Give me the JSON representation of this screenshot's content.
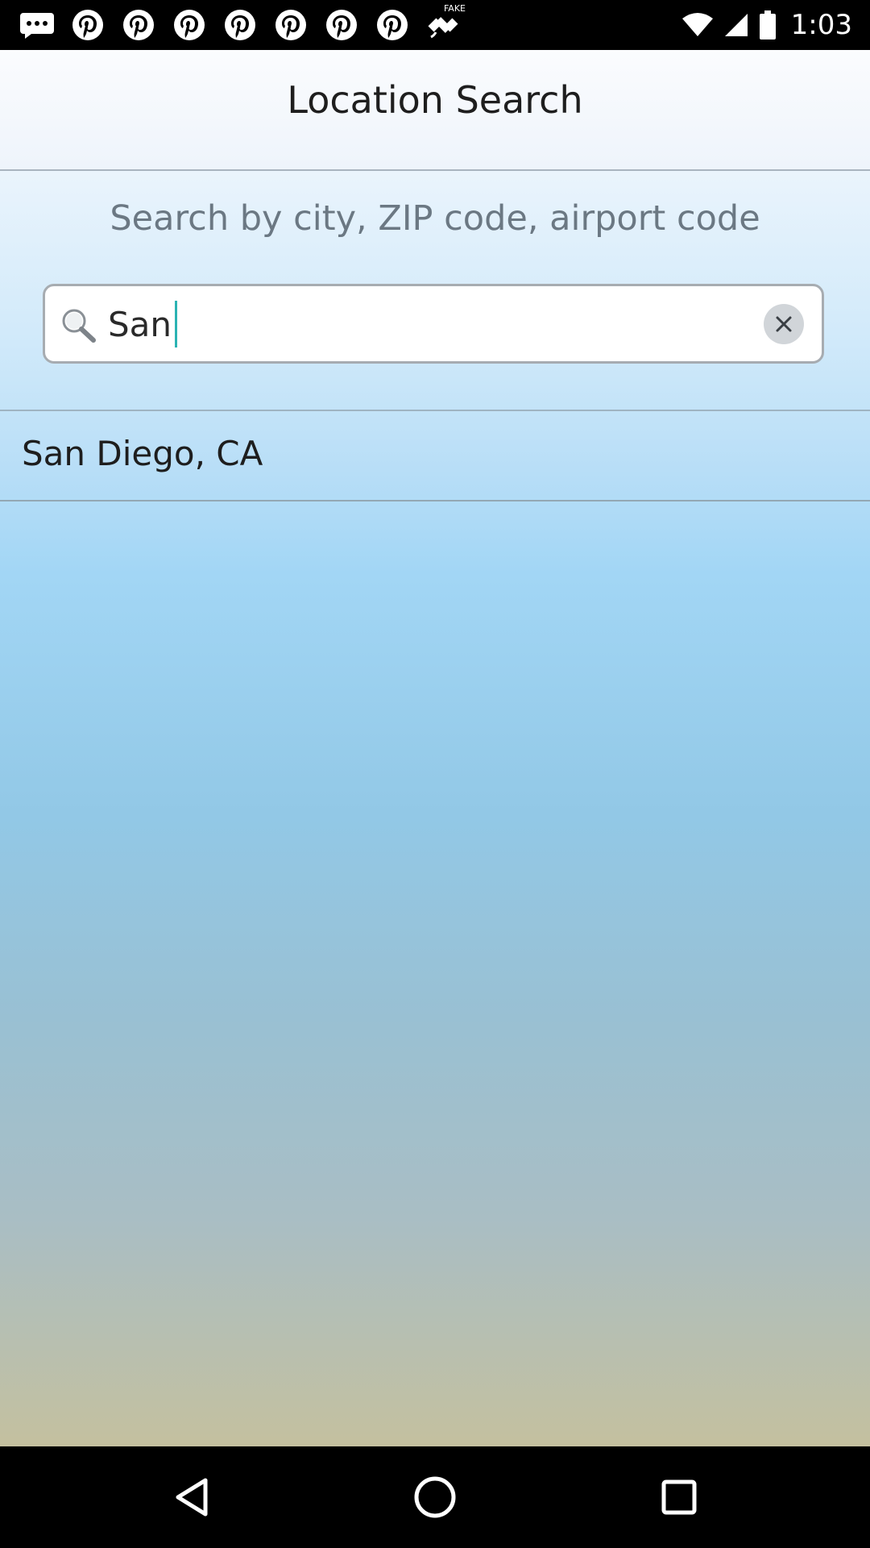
{
  "status_bar": {
    "time": "1:03",
    "left_icons": [
      "message-icon",
      "pinterest-icon",
      "pinterest-icon",
      "pinterest-icon",
      "pinterest-icon",
      "pinterest-icon",
      "pinterest-icon",
      "fake-gps-icon"
    ],
    "fake_gps_label": "FAKE",
    "right_icons": [
      "wifi-icon",
      "signal-icon",
      "battery-icon"
    ]
  },
  "header": {
    "title": "Location Search"
  },
  "search": {
    "subtitle": "Search by city, ZIP code, airport code",
    "value": "San"
  },
  "results": [
    {
      "label": "San Diego, CA"
    }
  ],
  "colors": {
    "caret": "#2bb3b3",
    "title_text": "#1e1e1e",
    "subtitle_text": "#6b7883"
  },
  "nav_bar": {
    "buttons": [
      "back-icon",
      "home-icon",
      "recents-icon"
    ]
  }
}
